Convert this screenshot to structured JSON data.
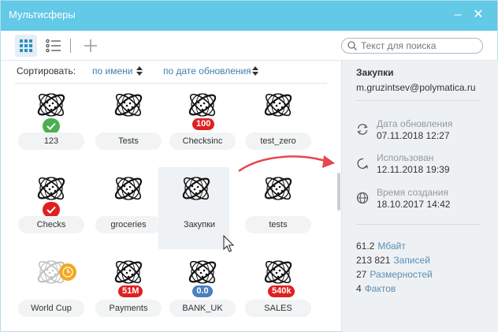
{
  "window": {
    "title": "Мультисферы",
    "minimize_glyph": "–",
    "close_glyph": "✕"
  },
  "toolbar": {
    "grid_view_icon": "grid-icon",
    "list_view_icon": "list-icon",
    "add_icon": "plus-icon",
    "search": {
      "placeholder": "Текст для поиска",
      "value": ""
    }
  },
  "sort": {
    "label": "Сортировать:",
    "options": [
      {
        "label": "по имени"
      },
      {
        "label": "по дате обновления"
      }
    ]
  },
  "spheres": [
    {
      "name": "123",
      "badge": {
        "type": "check",
        "color": "#4caf50"
      }
    },
    {
      "name": "Tests"
    },
    {
      "name": "Checksinc",
      "badge": {
        "type": "text",
        "text": "100",
        "color": "#e02020"
      }
    },
    {
      "name": "test_zero"
    },
    {
      "name": "Checks",
      "badge": {
        "type": "check",
        "color": "#e02020"
      }
    },
    {
      "name": "groceries"
    },
    {
      "name": "Закупки",
      "selected": true
    },
    {
      "name": "tests"
    },
    {
      "name": "World Cup",
      "badge": {
        "type": "clock",
        "color": "#f2a922"
      },
      "faded": true
    },
    {
      "name": "Payments",
      "badge": {
        "type": "text",
        "text": "51M",
        "color": "#e02020"
      }
    },
    {
      "name": "BANK_UK",
      "badge": {
        "type": "text",
        "text": "0.0",
        "color": "#4a7fc1"
      }
    },
    {
      "name": "SALES",
      "badge": {
        "type": "text",
        "text": "540k",
        "color": "#e02020"
      }
    }
  ],
  "details": {
    "title": "Закупки",
    "owner": "m.gruzintsev@polymatica.ru",
    "rows": [
      {
        "icon": "refresh-icon",
        "label": "Дата обновления",
        "value": "07.11.2018 12:27"
      },
      {
        "icon": "used-arrow-icon",
        "label": "Использован",
        "value": "12.11.2018 19:39"
      },
      {
        "icon": "globe-icon",
        "label": "Время создания",
        "value": "18.10.2017 14:42"
      }
    ],
    "stats": [
      {
        "value": "61.2",
        "unit": "Мбайт"
      },
      {
        "value": "213 821",
        "unit": "Записей"
      },
      {
        "value": "27",
        "unit": "Размерностей"
      },
      {
        "value": "4",
        "unit": "Фактов"
      }
    ]
  },
  "colors": {
    "titlebar": "#62c9e6",
    "accent_link": "#3f7fae",
    "badge_red": "#e02020",
    "badge_green": "#4caf50",
    "badge_blue": "#4a7fc1",
    "badge_orange": "#f2a922",
    "annotation_arrow": "#e8474d"
  }
}
